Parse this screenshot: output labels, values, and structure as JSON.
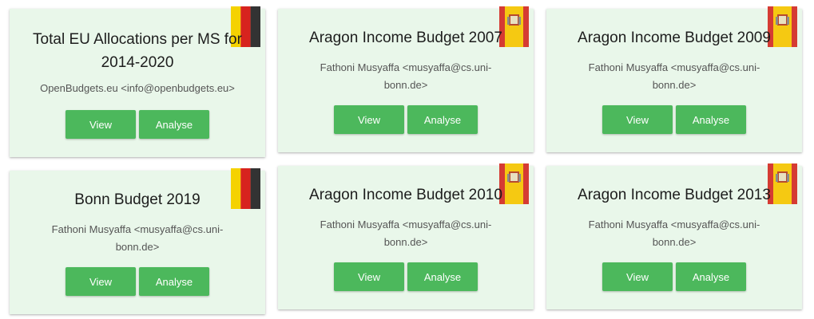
{
  "colors": {
    "card_bg": "#e9f7ea",
    "button_bg": "#4cb85c",
    "button_text": "#ffffff",
    "germany_flag": [
      "#f5d200",
      "#d7231e",
      "#333333"
    ],
    "spain_flag": [
      "#d53b33",
      "#f5c912"
    ]
  },
  "cards": [
    {
      "title": "Total EU Allocations per MS for 2014-2020",
      "owner": "OpenBudgets.eu <info@openbudgets.eu>",
      "view_label": "View",
      "analyse_label": "Analyse",
      "flag_icon": "germany-flag-icon"
    },
    {
      "title": "Aragon Income Budget 2007",
      "owner": "Fathoni Musyaffa <musyaffa@cs.uni-bonn.de>",
      "view_label": "View",
      "analyse_label": "Analyse",
      "flag_icon": "spain-flag-icon"
    },
    {
      "title": "Aragon Income Budget 2009",
      "owner": "Fathoni Musyaffa <musyaffa@cs.uni-bonn.de>",
      "view_label": "View",
      "analyse_label": "Analyse",
      "flag_icon": "spain-flag-icon"
    },
    {
      "title": "Bonn Budget 2019",
      "owner": "Fathoni Musyaffa <musyaffa@cs.uni-bonn.de>",
      "view_label": "View",
      "analyse_label": "Analyse",
      "flag_icon": "germany-flag-icon"
    },
    {
      "title": "Aragon Income Budget 2010",
      "owner": "Fathoni Musyaffa <musyaffa@cs.uni-bonn.de>",
      "view_label": "View",
      "analyse_label": "Analyse",
      "flag_icon": "spain-flag-icon"
    },
    {
      "title": "Aragon Income Budget 2013",
      "owner": "Fathoni Musyaffa <musyaffa@cs.uni-bonn.de>",
      "view_label": "View",
      "analyse_label": "Analyse",
      "flag_icon": "spain-flag-icon"
    }
  ]
}
